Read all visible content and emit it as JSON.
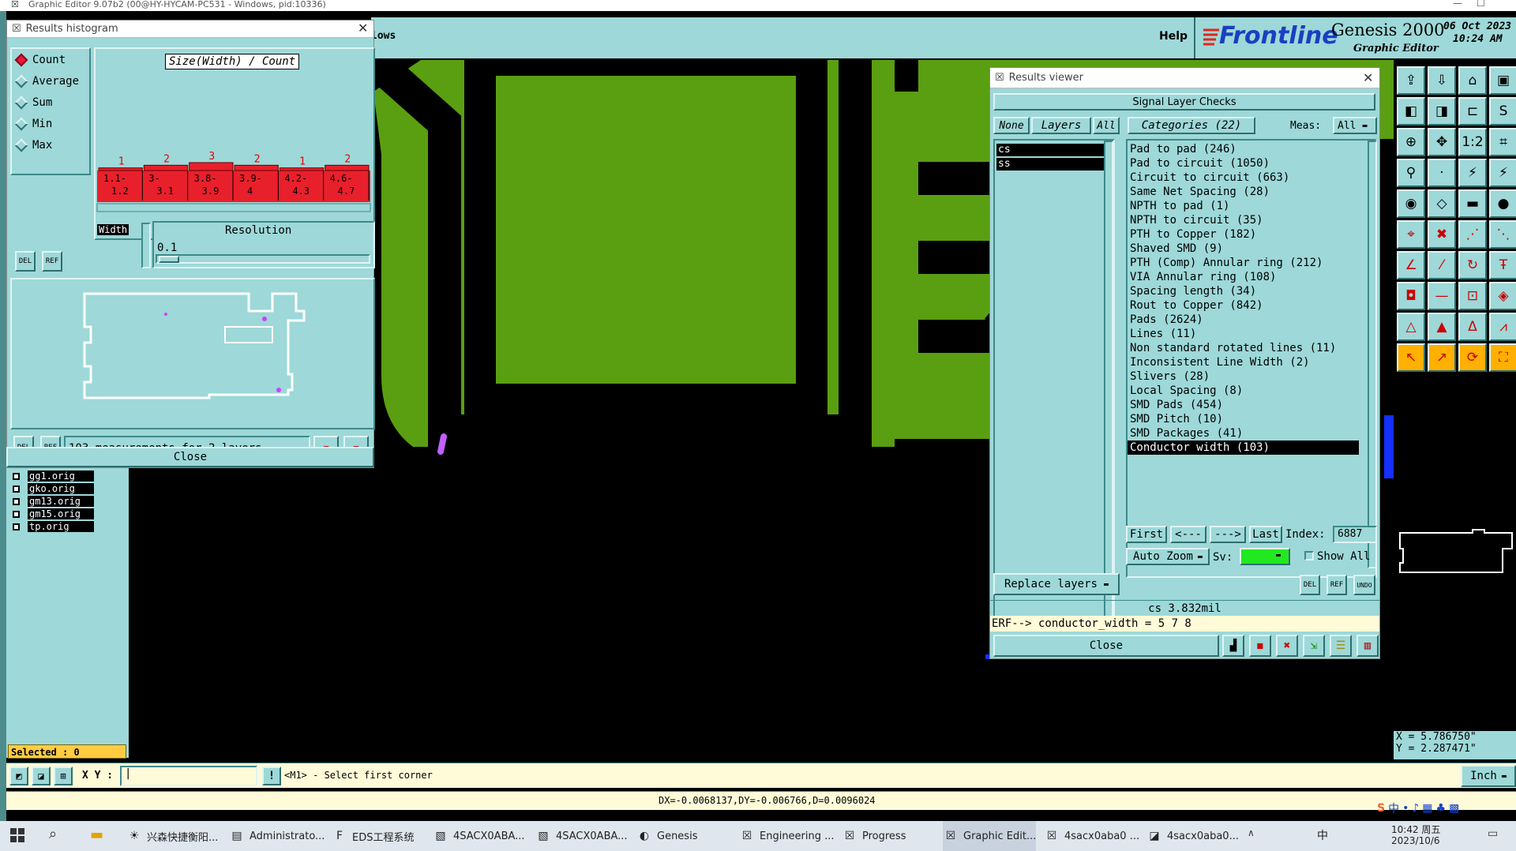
{
  "app": {
    "window_title": "Graphic Editor 9.07b2 (00@HY-HYCAM-PC531 - Windows, pid:10336)",
    "menu_partial": "lows",
    "help_label": "Help",
    "brand": "Frontline",
    "product": "Genesis 2000",
    "product_sub": "Graphic Editor",
    "date": "06 Oct 2023",
    "time": "10:24 AM"
  },
  "histogram": {
    "title": "Results histogram",
    "chart_title": "Size(Width) / Count",
    "modes": [
      "Count",
      "Average",
      "Sum",
      "Min",
      "Max"
    ],
    "selected_mode": "Count",
    "del_label": "DEL",
    "ref_label": "REF",
    "width_label": "Width",
    "resolution_label": "Resolution",
    "resolution_value": "0.1",
    "measurements": "103 measurements for 2 layers",
    "close_label": "Close"
  },
  "chart_data": {
    "type": "bar",
    "title": "Size(Width) / Count",
    "categories": [
      "1.1-1.2",
      "3-3.1",
      "3.8-3.9",
      "3.9-4",
      "4.2-4.3",
      "4.6-4.7"
    ],
    "values": [
      1,
      2,
      3,
      2,
      1,
      2
    ]
  },
  "layer_list": {
    "items": [
      "gg1.orig",
      "gko.orig",
      "gm13.orig",
      "gm15.orig",
      "tp.orig"
    ],
    "selected_label": "Selected : 0"
  },
  "results_viewer": {
    "title": "Results viewer",
    "header": "Signal Layer Checks",
    "none_label": "None",
    "layers_label": "Layers",
    "all_label": "All",
    "categories_label": "Categories (22)",
    "meas_label": "Meas:",
    "meas_value": "All",
    "layers": [
      "cs",
      "ss"
    ],
    "categories": [
      "Pad to pad (246)",
      "Pad to circuit (1050)",
      "Circuit to circuit (663)",
      "Same Net Spacing (28)",
      "NPTH to pad (1)",
      "NPTH to circuit (35)",
      "PTH to Copper (182)",
      "Shaved SMD (9)",
      "PTH (Comp) Annular ring (212)",
      "VIA Annular ring (108)",
      "Spacing length (34)",
      "Rout to Copper (842)",
      "Pads (2624)",
      "Lines (11)",
      "Non standard rotated lines (11)",
      "Inconsistent Line Width (2)",
      "Slivers (28)",
      "Local Spacing (8)",
      "SMD Pads (454)",
      "SMD Pitch (10)",
      "SMD Packages (41)",
      "Conductor width (103)"
    ],
    "selected_category": "Conductor width (103)",
    "first_label": "First",
    "prev_label": "<---",
    "next_label": "--->",
    "last_label": "Last",
    "index_label": "Index:",
    "index_value": "6887",
    "auto_zoom_label": "Auto Zoom",
    "sv_label": "Sv:",
    "show_all_label": "Show All",
    "replace_layers_label": "Replace layers",
    "del_label": "DEL",
    "ref_label": "REF",
    "undo_label": "UNDO",
    "measure_readout": "cs 3.832mil",
    "erf_line": "ERF--> conductor_width = 5 7 8",
    "close_label": "Close"
  },
  "status": {
    "xy_label": "X Y :",
    "prompt": "<M1> - Select first corner",
    "units": "Inch",
    "delta": "DX=-0.0068137,DY=-0.006766,D=0.0096024",
    "x_coord": "X = 5.786750\"",
    "y_coord": "Y = 2.287471\""
  },
  "taskbar": {
    "items": [
      "兴森快捷衡阳...",
      "Administrato...",
      "EDS工程系统",
      "4SACX0ABA...",
      "4SACX0ABA...",
      "Genesis",
      "Engineering ...",
      "Progress",
      "Graphic Edit...",
      "4sacx0aba0 ...",
      "4sacx0aba0..."
    ],
    "tray_ime": "中",
    "tray_ime2": "中",
    "clock_time": "10:42 周五",
    "clock_date": "2023/10/6"
  },
  "colors": {
    "teal": "#9ed8d8",
    "copper_green": "#5a9e12",
    "bar_red": "#e8202c",
    "highlight_yellow": "#fffbd8"
  }
}
